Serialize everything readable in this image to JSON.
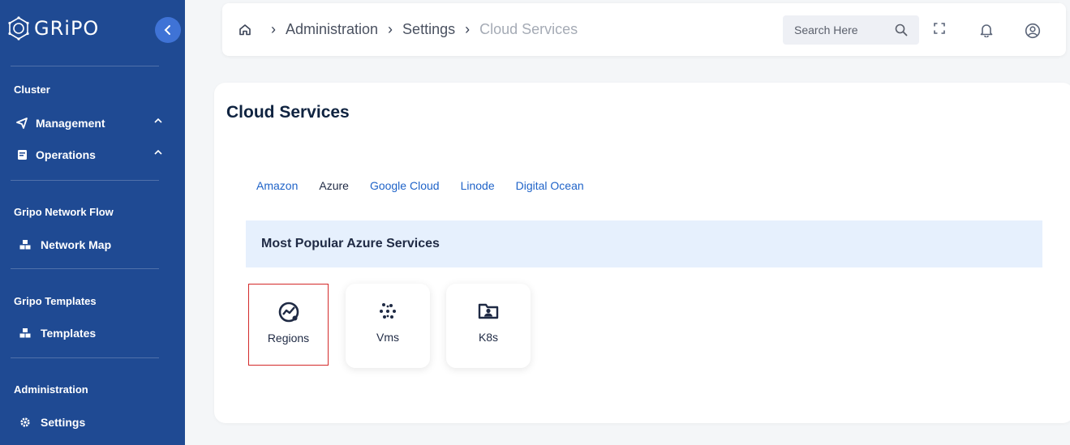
{
  "sidebar": {
    "brand": "GRiPO",
    "sections": [
      {
        "title": "Cluster",
        "items": [
          {
            "label": "Management",
            "icon": "send-icon"
          },
          {
            "label": "Operations",
            "icon": "document-icon"
          }
        ]
      },
      {
        "title": "Gripo Network Flow",
        "items": [
          {
            "label": "Network Map",
            "icon": "cubes-icon"
          }
        ]
      },
      {
        "title": "Gripo Templates",
        "items": [
          {
            "label": "Templates",
            "icon": "cubes-icon"
          }
        ]
      },
      {
        "title": "Administration",
        "items": [
          {
            "label": "Settings",
            "icon": "gear-icon"
          }
        ]
      }
    ],
    "bg_color": "#1f4a93",
    "accent_color": "#3f73d6"
  },
  "header": {
    "breadcrumb": [
      "Administration",
      "Settings",
      "Cloud Services"
    ],
    "search_placeholder": "Search Here"
  },
  "main": {
    "title": "Cloud Services",
    "tabs": [
      "Amazon",
      "Azure",
      "Google Cloud",
      "Linode",
      "Digital Ocean"
    ],
    "active_tab": "Azure",
    "banner": "Most Popular Azure Services",
    "services": [
      {
        "label": "Regions",
        "icon": "chart-circle-icon",
        "selected": true
      },
      {
        "label": "Vms",
        "icon": "dots-cluster-icon",
        "selected": false
      },
      {
        "label": "K8s",
        "icon": "folder-user-icon",
        "selected": false
      }
    ],
    "tab_color": "#1f63c8",
    "banner_color": "#e6f0fd",
    "selected_border_color": "#d42a2a"
  }
}
